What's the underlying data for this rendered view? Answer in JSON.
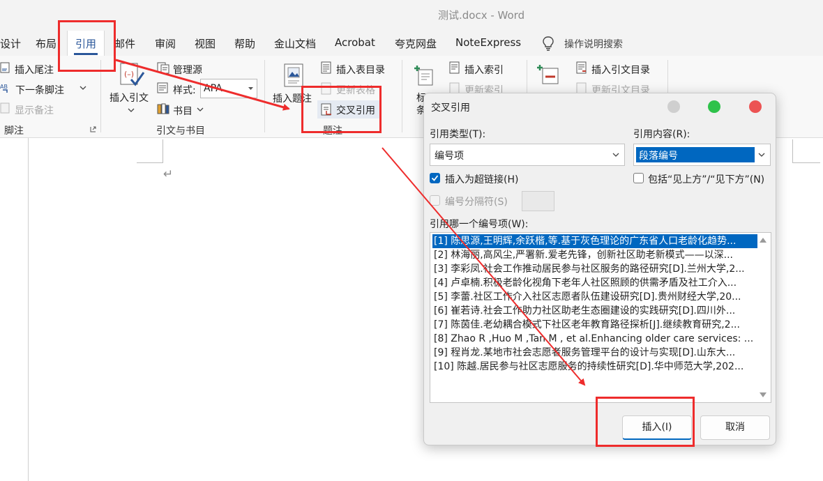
{
  "window": {
    "title": "测试.docx  -  Word"
  },
  "tabs": [
    "设计",
    "布局",
    "引用",
    "邮件",
    "审阅",
    "视图",
    "帮助",
    "金山文档",
    "Acrobat",
    "夸克网盘",
    "NoteExpress"
  ],
  "active_tab": "引用",
  "tell_me": "操作说明搜索",
  "ribbon": {
    "footnotes": {
      "insert_endnote": "插入尾注",
      "next_footnote": "下一条脚注",
      "show_notes": "显示备注",
      "group_label": "脚注"
    },
    "citations": {
      "insert_citation": "插入引文",
      "manage_sources": "管理源",
      "style_label": "样式:",
      "style_value": "APA",
      "bibliography": "书目",
      "group_label": "引文与书目"
    },
    "captions": {
      "insert_caption": "插入题注",
      "insert_table_of_figures": "插入表目录",
      "update_table": "更新表格",
      "cross_reference": "交叉引用",
      "group_label": "题注"
    },
    "index": {
      "mark_entry_partial": "标",
      "mark_entry_partial2": "条",
      "insert_index": "插入索引",
      "update_index": "更新索引"
    },
    "toa": {
      "insert_toa": "插入引文目录",
      "update_toa": "更新引文目录"
    }
  },
  "dialog": {
    "title": "交叉引用",
    "reference_type_label": "引用类型(T):",
    "reference_type_value": "编号项",
    "insert_reference_to_label": "引用内容(R):",
    "insert_reference_to_value": "段落编号",
    "insert_as_hyperlink": "插入为超链接(H)",
    "insert_as_hyperlink_checked": true,
    "include_above_below": "包括“见上方”/“见下方”(N)",
    "include_above_below_checked": false,
    "separate_numbers": "编号分隔符(S)",
    "for_which_label": "引用哪一个编号项(W):",
    "items": [
      "[1] 陈思源,王明辉,余跃楷,等.基于灰色理论的广东省人口老龄化趋势...",
      "[2] 林海丽,高风尘,严署新.爱老先锋，创新社区助老新模式——以深...",
      "[3] 李彩凤.社会工作推动居民参与社区服务的路径研究[D].兰州大学,2...",
      "[4] 卢卓楠.积极老龄化视角下老年人社区照顾的供需矛盾及社工介入...",
      "[5] 李蕾.社区工作介入社区志愿者队伍建设研究[D].贵州财经大学,20...",
      "[6] 崔若诗.社会工作助力社区助老生态圈建设的实践研究[D].四川外...",
      "[7] 陈茵佳.老幼耦合模式下社区老年教育路径探析[J].继续教育研究,2...",
      "[8] Zhao R ,Huo M ,Tan M , et al.Enhancing older care services: ...",
      "[9] 程肖龙.某地市社会志愿者服务管理平台的设计与实现[D].山东大...",
      "[10] 陈越.居民参与社区志愿服务的持续性研究[D].华中师范大学,202..."
    ],
    "selected_index": 0,
    "insert_button": "插入(I)",
    "cancel_button": "取消"
  },
  "colors": {
    "annotation_red": "#ee2c2c",
    "accent_blue": "#0067c0",
    "word_blue": "#2b579a"
  }
}
